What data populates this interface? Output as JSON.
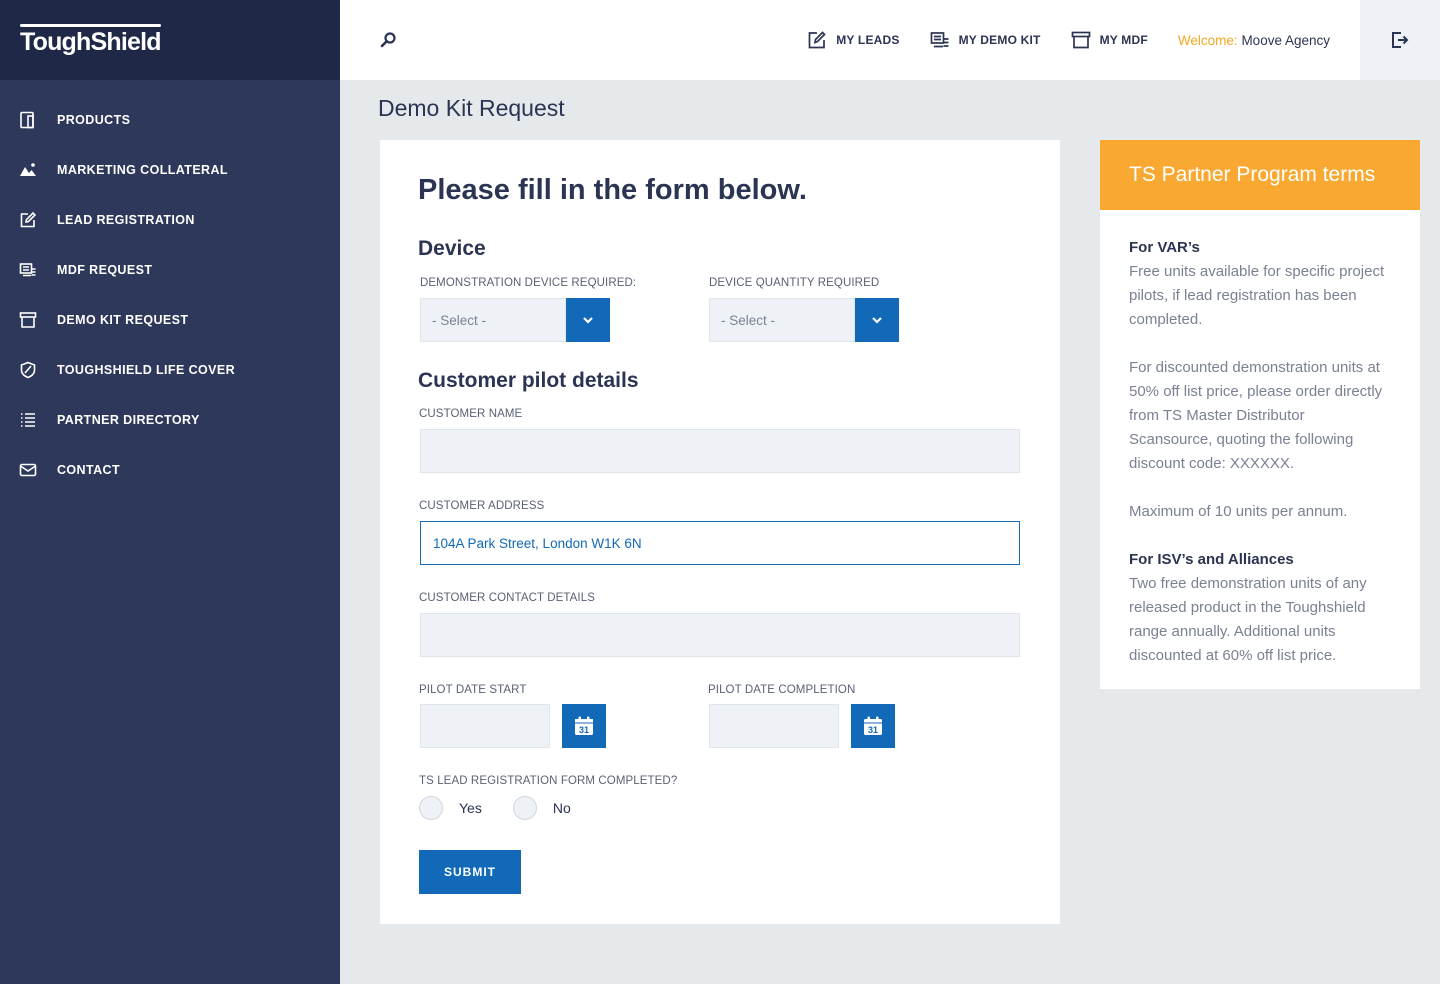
{
  "brand": {
    "logo_text": "ToughShield"
  },
  "sidebar": {
    "items": [
      {
        "label": "PRODUCTS",
        "icon": "tablet-icon"
      },
      {
        "label": "MARKETING COLLATERAL",
        "icon": "image-icon"
      },
      {
        "label": "LEAD REGISTRATION",
        "icon": "edit-icon"
      },
      {
        "label": "MDF REQUEST",
        "icon": "money-icon"
      },
      {
        "label": "DEMO KIT REQUEST",
        "icon": "archive-icon"
      },
      {
        "label": "TOUGHSHIELD LIFE COVER",
        "icon": "shield-icon"
      },
      {
        "label": "PARTNER DIRECTORY",
        "icon": "list-icon"
      },
      {
        "label": "CONTACT",
        "icon": "mail-icon"
      }
    ]
  },
  "topbar": {
    "links": [
      {
        "label": "MY LEADS",
        "icon": "edit-icon"
      },
      {
        "label": "MY DEMO KIT",
        "icon": "money-icon"
      },
      {
        "label": "MY MDF",
        "icon": "archive-icon"
      }
    ],
    "welcome_prefix": "Welcome:",
    "welcome_name": "Moove Agency"
  },
  "page": {
    "title": "Demo Kit Request"
  },
  "form": {
    "heading": "Please fill in the form below.",
    "device_section": "Device",
    "device_label": "DEMONSTRATION DEVICE REQUIRED:",
    "device_value": "- Select -",
    "quantity_label": "DEVICE QUANTITY REQUIRED",
    "quantity_value": "- Select -",
    "customer_section": "Customer pilot details",
    "customer_name_label": "CUSTOMER NAME",
    "customer_name_value": "",
    "customer_address_label": "CUSTOMER ADDRESS",
    "customer_address_value": "104A Park Street, London W1K 6N",
    "customer_contact_label": "CUSTOMER CONTACT DETAILS",
    "customer_contact_value": "",
    "pilot_start_label": "PILOT DATE START",
    "pilot_completion_label": "PILOT DATE COMPLETION",
    "calendar_day": "31",
    "lead_reg_label": "TS LEAD REGISTRATION FORM COMPLETED?",
    "radio_yes": "Yes",
    "radio_no": "No",
    "submit_label": "SUBMIT"
  },
  "terms": {
    "title": "TS Partner Program terms",
    "var_heading": "For VAR’s",
    "var_p1": "Free units available for specific project pilots, if lead registration has been completed.",
    "var_p2": "For discounted demonstration units at 50% off list price, please order directly from TS Master Distributor Scansource, quoting the following discount code: XXXXXX.",
    "var_p3": "Maximum of 10 units per annum.",
    "isv_heading": "For ISV’s and Alliances",
    "isv_p1": "Two free demonstration units of any released product in the Toughshield range annually. Additional units discounted at 60% off list price."
  },
  "colors": {
    "sidebar_bg": "#2e385a",
    "logo_bg": "#1f2847",
    "accent_blue": "#1269b8",
    "accent_orange": "#f9a931",
    "text_dark": "#2b3452"
  }
}
